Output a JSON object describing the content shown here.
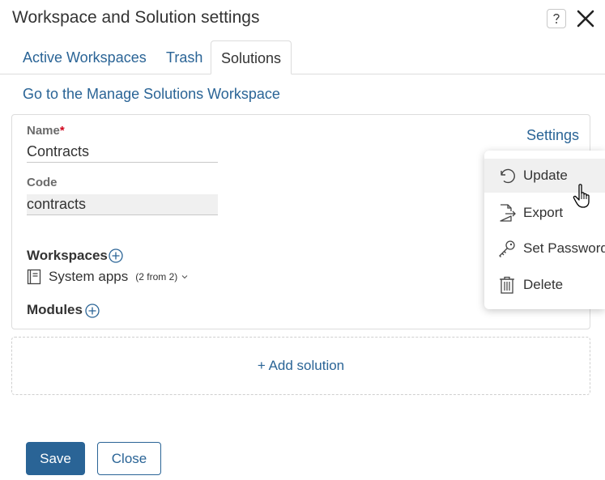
{
  "dialog": {
    "title": "Workspace and Solution settings",
    "help_icon": "question-mark-icon",
    "close_icon": "close-icon"
  },
  "tabs": [
    {
      "label": "Active Workspaces",
      "active": false
    },
    {
      "label": "Trash",
      "active": false
    },
    {
      "label": "Solutions",
      "active": true
    }
  ],
  "manage_link": "Go to the Manage Solutions Workspace",
  "solution": {
    "name_label": "Name",
    "name_required_mark": "*",
    "name_value": "Contracts",
    "code_label": "Code",
    "code_value": "contracts",
    "settings_link": "Settings",
    "workspaces_label": "Workspaces",
    "workspace_item": {
      "name": "System apps",
      "count": "(2 from 2)"
    },
    "modules_label": "Modules"
  },
  "settings_menu": [
    {
      "label": "Update",
      "icon": "undo-icon"
    },
    {
      "label": "Export",
      "icon": "export-file-icon"
    },
    {
      "label": "Set Password",
      "icon": "key-icon"
    },
    {
      "label": "Delete",
      "icon": "trash-icon"
    }
  ],
  "add_solution": "+ Add solution",
  "footer": {
    "save": "Save",
    "close": "Close"
  },
  "colors": {
    "accent": "#2a6496",
    "required": "#d0021b",
    "border": "#dcdcdc"
  }
}
